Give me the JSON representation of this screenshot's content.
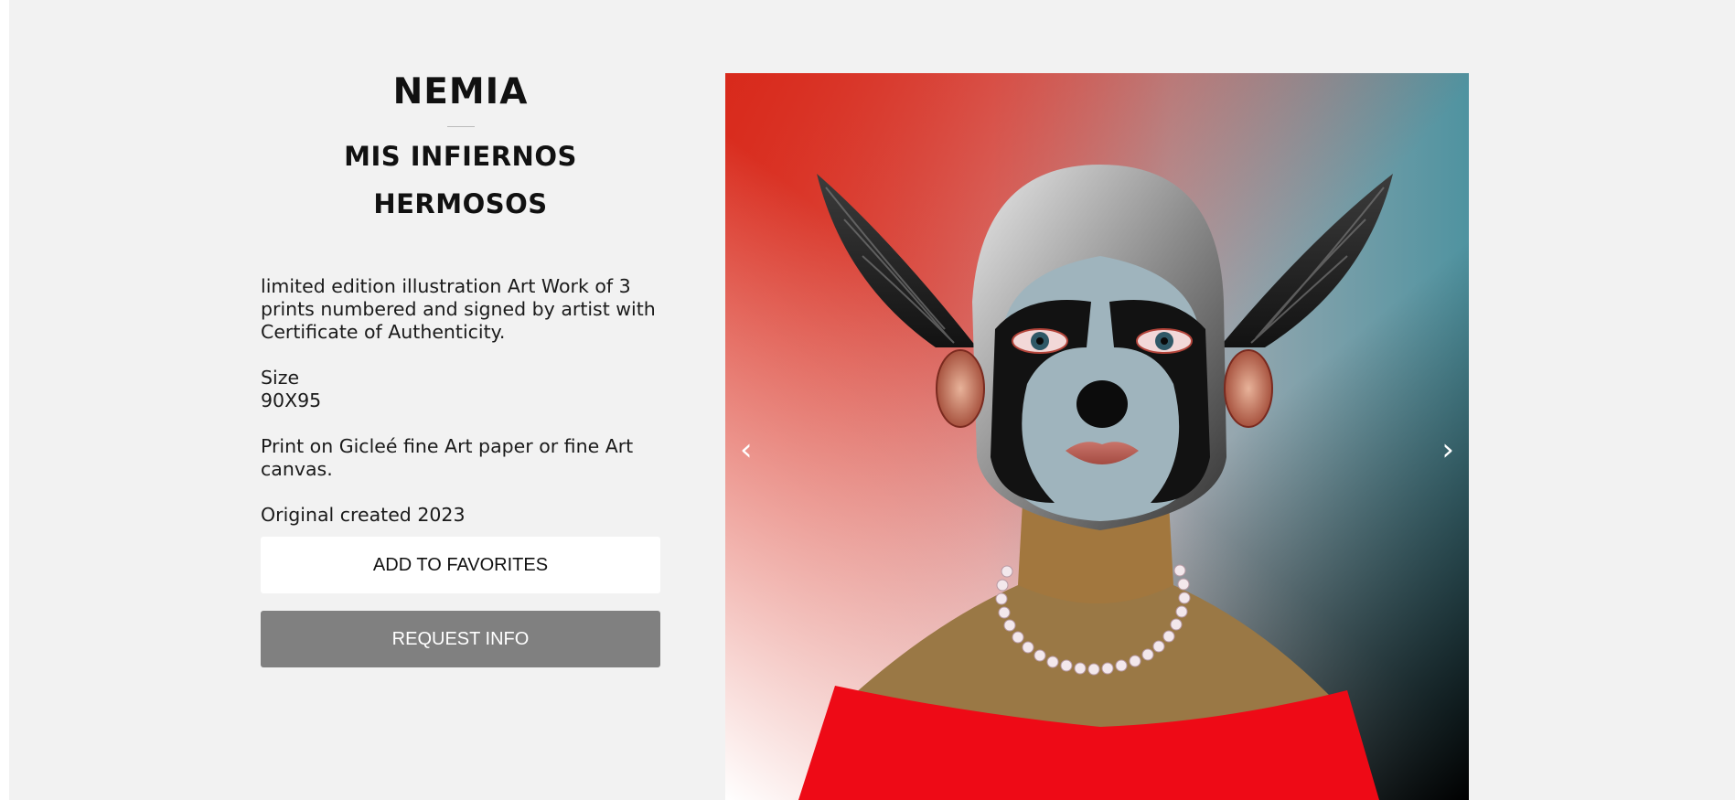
{
  "artwork": {
    "artist": "NEMIA",
    "title": "MIS INFIERNOS HERMOSOS",
    "description": [
      "limited edition illustration Art Work of 3 prints numbered and signed by artist with Certificate of Authenticity.",
      "Size",
      "90X95",
      "Print on Gicleé fine Art paper or fine Art canvas.",
      "Original created 2023"
    ]
  },
  "actions": {
    "favorites_label": "ADD TO FAVORITES",
    "request_label": "REQUEST INFO"
  },
  "gallery": {
    "prev_icon": "‹",
    "next_icon": "›"
  },
  "colors": {
    "page_background": "#f2f2f2",
    "request_button": "#808080",
    "favorites_button": "#ffffff"
  }
}
